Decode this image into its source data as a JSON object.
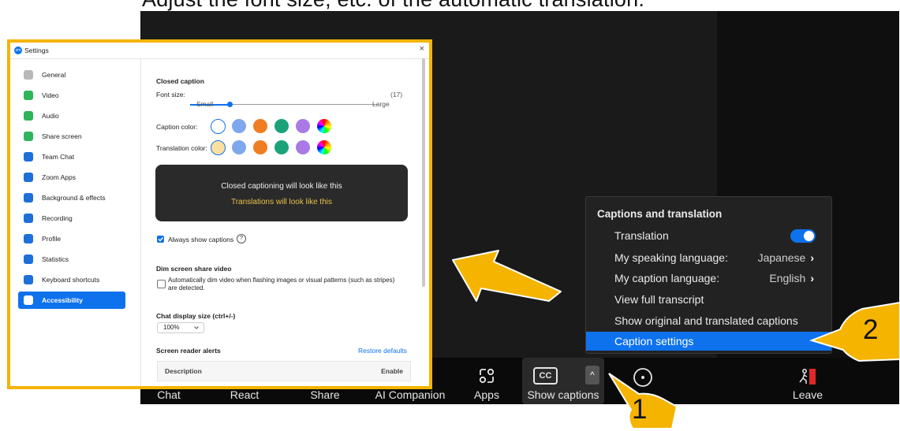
{
  "heading": "Adjust the font size, etc. of the automatic translation.",
  "toolbar": {
    "chat": "Chat",
    "react": "React",
    "share": "Share",
    "ai_companion": "AI Companion",
    "apps": "Apps",
    "cc_icon": "CC",
    "show_captions": "Show captions",
    "leave": "Leave"
  },
  "menu": {
    "title": "Captions and translation",
    "translation": "Translation",
    "speaking_label": "My speaking language:",
    "speaking_value": "Japanese",
    "caption_label": "My caption language:",
    "caption_value": "English",
    "transcript": "View full transcript",
    "original_translated": "Show original and translated captions",
    "caption_settings": "Caption settings",
    "chevron": "›"
  },
  "settings": {
    "window_title": "Settings",
    "logo_text": "zm",
    "close": "×",
    "nav": [
      {
        "label": "General",
        "color": "#b8b8b8"
      },
      {
        "label": "Video",
        "color": "#2fb35b"
      },
      {
        "label": "Audio",
        "color": "#2fb35b"
      },
      {
        "label": "Share screen",
        "color": "#2fb35b"
      },
      {
        "label": "Team Chat",
        "color": "#1e6fd9"
      },
      {
        "label": "Zoom Apps",
        "color": "#1e6fd9"
      },
      {
        "label": "Background & effects",
        "color": "#1e6fd9"
      },
      {
        "label": "Recording",
        "color": "#1e6fd9"
      },
      {
        "label": "Profile",
        "color": "#1e6fd9"
      },
      {
        "label": "Statistics",
        "color": "#1e6fd9"
      },
      {
        "label": "Keyboard shortcuts",
        "color": "#1e6fd9"
      },
      {
        "label": "Accessibility",
        "color": "#ffffff"
      }
    ],
    "closed_caption": "Closed caption",
    "font_size": "Font size:",
    "font_value": "(17)",
    "small": "Small",
    "large": "Large",
    "caption_color": "Caption color:",
    "translation_color": "Translation color:",
    "preview_caption": "Closed captioning will look like this",
    "preview_translation": "Translations will look like this",
    "always_show": "Always show captions",
    "help": "?",
    "dim_title": "Dim screen share video",
    "dim_desc_1": "Automatically dim video when flashing images or visual patterns (such as stripes)",
    "dim_desc_2": "are detected.",
    "chat_size": "Chat display size (ctrl+/-)",
    "chat_value": "100%",
    "reader_alerts": "Screen reader alerts",
    "restore": "Restore defaults",
    "col_description": "Description",
    "col_enable": "Enable"
  },
  "annotations": {
    "one": "1",
    "two": "2"
  },
  "colors": {
    "accent": "#0e72ed",
    "highlight_border": "#f5b400",
    "translation_text": "#e8c04a",
    "swatches": [
      "#ffffff",
      "#7ea7ee",
      "#f07d22",
      "#1aa37a",
      "#a97ae6",
      "rainbow"
    ],
    "translation_swatches": [
      "#fbe0a0",
      "#7ea7ee",
      "#f07d22",
      "#1aa37a",
      "#a97ae6",
      "rainbow"
    ]
  }
}
